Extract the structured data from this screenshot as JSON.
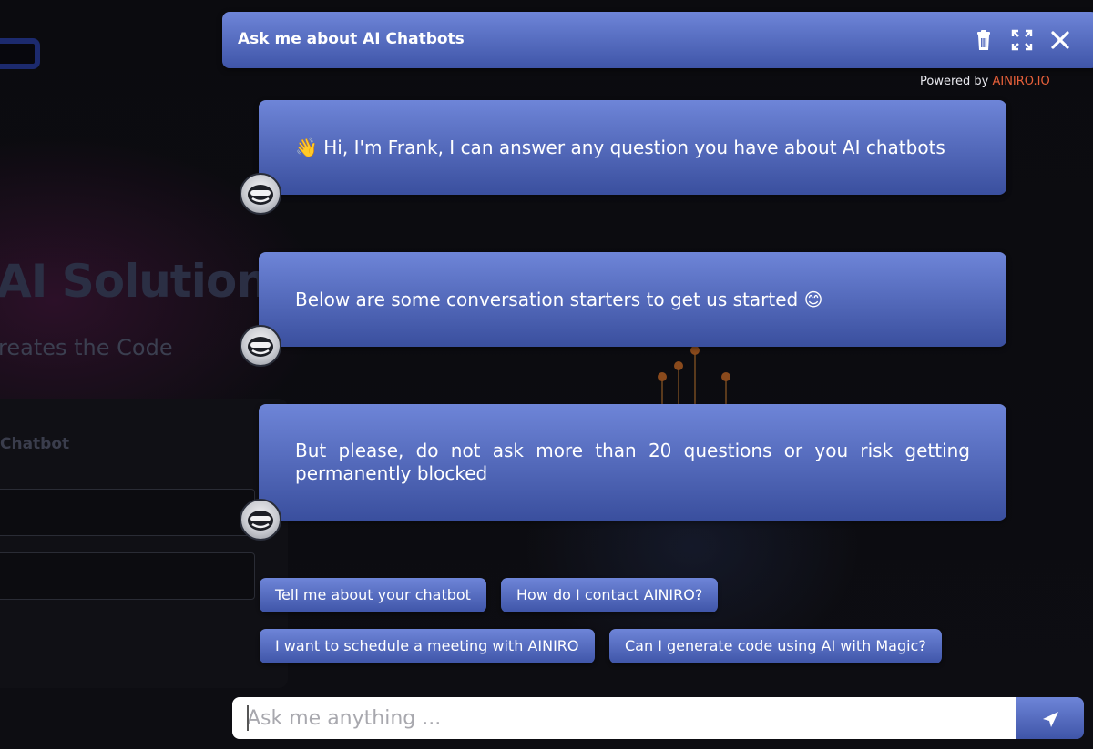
{
  "background": {
    "heading": "AI Solutions",
    "subheading": "reates the Code",
    "card_title": "Chatbot"
  },
  "chat": {
    "title": "Ask me about AI Chatbots",
    "powered_by_prefix": "Powered by ",
    "powered_by_brand": "AINIRO.IO",
    "icons": {
      "clear": "trash-icon",
      "expand": "expand-icon",
      "close": "close-icon"
    },
    "messages": [
      {
        "text": "👋 Hi, I'm Frank, I can answer any question you have about AI chatbots"
      },
      {
        "text": "Below are some conversation starters to get us started 😊"
      },
      {
        "text": "But please, do not ask more than 20 questions or you risk getting permanently blocked"
      }
    ],
    "suggestions": [
      "Tell me about your chatbot",
      "How do I contact AINIRO?",
      "I want to schedule a meeting with AINIRO",
      "Can I generate code using AI with Magic?"
    ],
    "input": {
      "placeholder": "Ask me anything ...",
      "value": ""
    },
    "send_icon": "send-icon"
  },
  "colors": {
    "accent_top": "#6e85d8",
    "accent_bottom": "#3f55a8",
    "brand": "#e8603a"
  }
}
